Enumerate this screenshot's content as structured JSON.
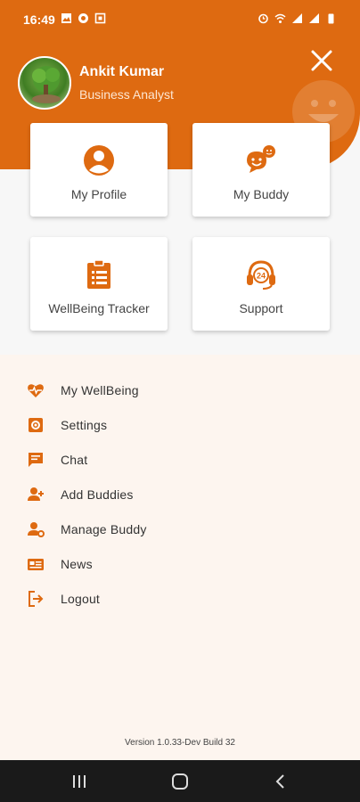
{
  "status_bar": {
    "time": "16:49",
    "left_icons": [
      "image-icon",
      "whatsapp-icon",
      "notification-icon"
    ],
    "right_icons": [
      "alarm-icon",
      "wifi-icon",
      "signal-icon",
      "signal-icon",
      "battery-icon"
    ]
  },
  "profile": {
    "name": "Ankit Kumar",
    "role": "Business Analyst"
  },
  "cards": [
    {
      "label": "My Profile",
      "icon": "user-icon"
    },
    {
      "label": "My Buddy",
      "icon": "chat-faces-icon"
    },
    {
      "label": "WellBeing Tracker",
      "icon": "clipboard-icon"
    },
    {
      "label": "Support",
      "icon": "headset-24-icon"
    }
  ],
  "menu": [
    {
      "label": "My WellBeing",
      "icon": "heart-pulse-icon"
    },
    {
      "label": "Settings",
      "icon": "gear-icon"
    },
    {
      "label": "Chat",
      "icon": "chat-icon"
    },
    {
      "label": "Add Buddies",
      "icon": "add-user-icon"
    },
    {
      "label": "Manage Buddy",
      "icon": "manage-user-icon"
    },
    {
      "label": "News",
      "icon": "news-icon"
    },
    {
      "label": "Logout",
      "icon": "logout-icon"
    }
  ],
  "version": "Version 1.0.33-Dev Build 32",
  "colors": {
    "accent": "#de6a11",
    "menu_bg": "#fdf5ef",
    "page_bg": "#f7f7f7"
  }
}
